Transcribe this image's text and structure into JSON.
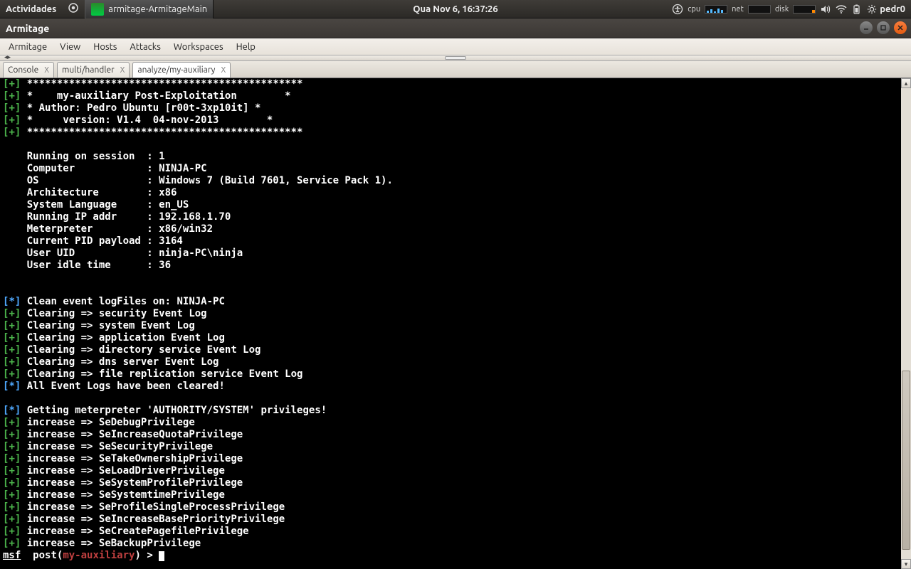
{
  "topbar": {
    "activities": "Actividades",
    "taskbar_app": "armitage-ArmitageMain",
    "clock": "Qua Nov  6, 16:37:26",
    "indicators": {
      "cpu": "cpu",
      "net": "net",
      "disk": "disk"
    },
    "username": "pedr0"
  },
  "window": {
    "title": "Armitage",
    "menus": [
      "Armitage",
      "View",
      "Hosts",
      "Attacks",
      "Workspaces",
      "Help"
    ]
  },
  "tabs": [
    {
      "label": "Console"
    },
    {
      "label": "multi/handler"
    },
    {
      "label": "analyze/my-auxiliary",
      "active": true
    }
  ],
  "console": {
    "prompt": {
      "msf": "msf",
      "left": "  post(",
      "module": "my-auxiliary",
      "right": ") > "
    },
    "lines": [
      {
        "p": "[+]",
        "t": " **********************************************"
      },
      {
        "p": "[+]",
        "t": " *    my-auxiliary Post-Exploitation        *"
      },
      {
        "p": "[+]",
        "t": " * Author: Pedro Ubuntu [r00t-3xp10it] *"
      },
      {
        "p": "[+]",
        "t": " *     version: V1.4  04-nov-2013        *"
      },
      {
        "p": "[+]",
        "t": " **********************************************"
      },
      {
        "p": "",
        "t": ""
      },
      {
        "p": "",
        "t": "    Running on session  : 1"
      },
      {
        "p": "",
        "t": "    Computer            : NINJA-PC"
      },
      {
        "p": "",
        "t": "    OS                  : Windows 7 (Build 7601, Service Pack 1)."
      },
      {
        "p": "",
        "t": "    Architecture        : x86"
      },
      {
        "p": "",
        "t": "    System Language     : en_US"
      },
      {
        "p": "",
        "t": "    Running IP addr     : 192.168.1.70"
      },
      {
        "p": "",
        "t": "    Meterpreter         : x86/win32"
      },
      {
        "p": "",
        "t": "    Current PID payload : 3164"
      },
      {
        "p": "",
        "t": "    User UID            : ninja-PC\\ninja"
      },
      {
        "p": "",
        "t": "    User idle time      : 36"
      },
      {
        "p": "",
        "t": ""
      },
      {
        "p": "",
        "t": ""
      },
      {
        "p": "[*]",
        "t": " Clean event logFiles on: NINJA-PC"
      },
      {
        "p": "[+]",
        "t": " Clearing => security Event Log"
      },
      {
        "p": "[+]",
        "t": " Clearing => system Event Log"
      },
      {
        "p": "[+]",
        "t": " Clearing => application Event Log"
      },
      {
        "p": "[+]",
        "t": " Clearing => directory service Event Log"
      },
      {
        "p": "[+]",
        "t": " Clearing => dns server Event Log"
      },
      {
        "p": "[+]",
        "t": " Clearing => file replication service Event Log"
      },
      {
        "p": "[*]",
        "t": " All Event Logs have been cleared!"
      },
      {
        "p": "",
        "t": ""
      },
      {
        "p": "[*]",
        "t": " Getting meterpreter 'AUTHORITY/SYSTEM' privileges!"
      },
      {
        "p": "[+]",
        "t": " increase => SeDebugPrivilege"
      },
      {
        "p": "[+]",
        "t": " increase => SeIncreaseQuotaPrivilege"
      },
      {
        "p": "[+]",
        "t": " increase => SeSecurityPrivilege"
      },
      {
        "p": "[+]",
        "t": " increase => SeTakeOwnershipPrivilege"
      },
      {
        "p": "[+]",
        "t": " increase => SeLoadDriverPrivilege"
      },
      {
        "p": "[+]",
        "t": " increase => SeSystemProfilePrivilege"
      },
      {
        "p": "[+]",
        "t": " increase => SeSystemtimePrivilege"
      },
      {
        "p": "[+]",
        "t": " increase => SeProfileSingleProcessPrivilege"
      },
      {
        "p": "[+]",
        "t": " increase => SeIncreaseBasePriorityPrivilege"
      },
      {
        "p": "[+]",
        "t": " increase => SeCreatePagefilePrivilege"
      },
      {
        "p": "[+]",
        "t": " increase => SeBackupPrivilege"
      }
    ]
  }
}
